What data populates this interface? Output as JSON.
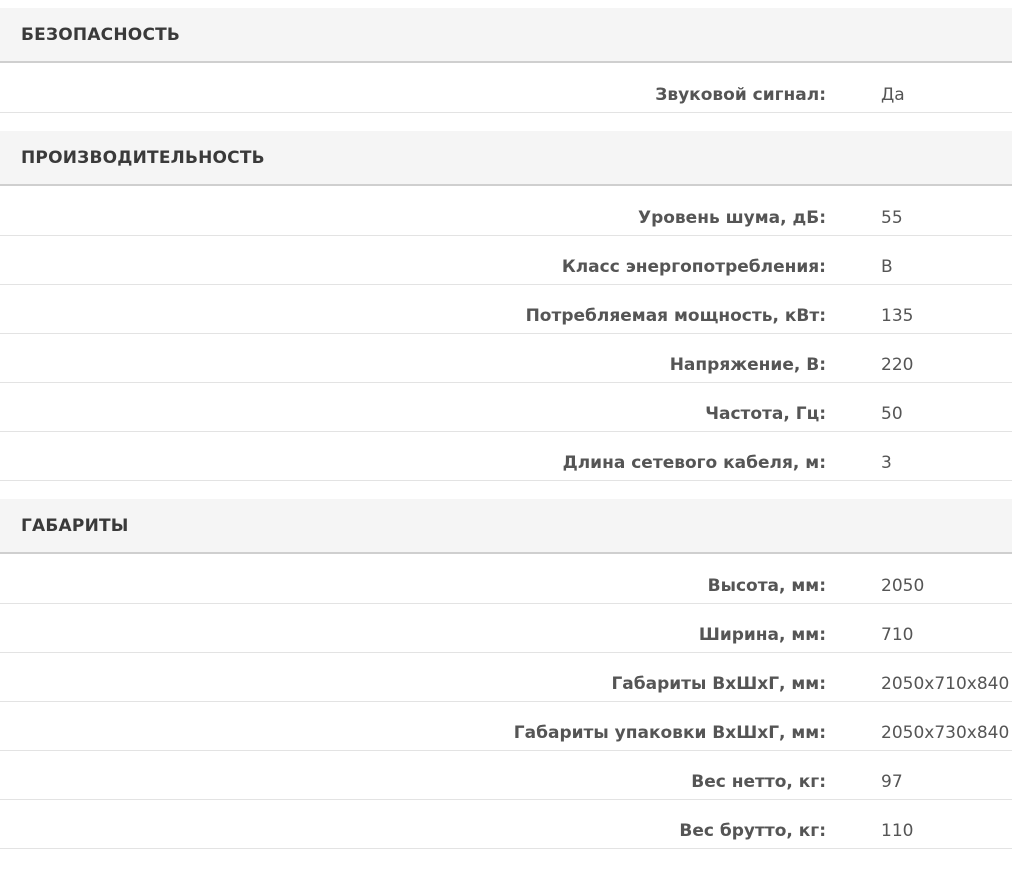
{
  "sections": [
    {
      "title": "БЕЗОПАСНОСТЬ",
      "rows": [
        {
          "name": "Звуковой сигнал:",
          "value": "Да"
        }
      ]
    },
    {
      "title": "ПРОИЗВОДИТЕЛЬНОСТЬ",
      "rows": [
        {
          "name": "Уровень шума, дБ:",
          "value": "55"
        },
        {
          "name": "Класс энергопотребления:",
          "value": "B"
        },
        {
          "name": "Потребляемая мощность, кВт:",
          "value": "135"
        },
        {
          "name": "Напряжение, В:",
          "value": "220"
        },
        {
          "name": "Частота, Гц:",
          "value": "50"
        },
        {
          "name": "Длина сетевого кабеля, м:",
          "value": "3"
        }
      ]
    },
    {
      "title": "ГАБАРИТЫ",
      "rows": [
        {
          "name": "Высота, мм:",
          "value": "2050"
        },
        {
          "name": "Ширина, мм:",
          "value": "710"
        },
        {
          "name": "Габариты ВхШхГ, мм:",
          "value": "2050x710x840"
        },
        {
          "name": "Габариты упаковки ВхШхГ, мм:",
          "value": "2050x730x840"
        },
        {
          "name": "Вес нетто, кг:",
          "value": "97"
        },
        {
          "name": "Вес брутто, кг:",
          "value": "110"
        }
      ]
    }
  ]
}
